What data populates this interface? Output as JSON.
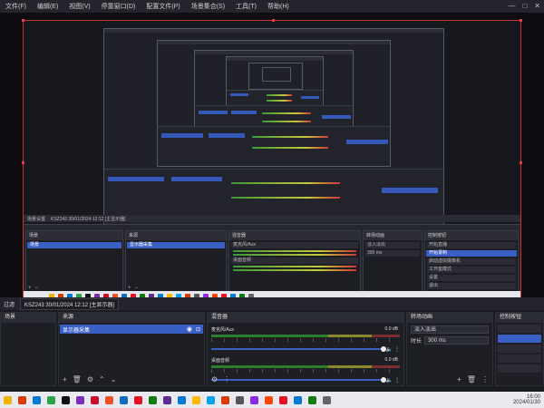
{
  "window": {
    "menu": [
      "文件(F)",
      "编辑(E)",
      "视图(V)",
      "停靠窗口(D)",
      "配置文件(P)",
      "场景集合(S)",
      "工具(T)",
      "帮助(H)"
    ],
    "controls": [
      "—",
      "□",
      "✕"
    ]
  },
  "scene_toolbar": {
    "label": "过滤",
    "source_name": "KSZ243 30/01/2024 12:12 [主显示器]"
  },
  "panels": {
    "scenes": {
      "title": "场景",
      "items": []
    },
    "sources": {
      "title": "来源",
      "items": [
        {
          "label": "显示器采集"
        }
      ]
    },
    "mixer": {
      "title": "混音器",
      "channels": [
        {
          "name": "麦克风/Aux",
          "db": "0.0 dB"
        },
        {
          "name": "桌面音频",
          "db": "0.0 dB"
        }
      ]
    },
    "transitions": {
      "title": "转场动画",
      "type": "淡入淡出",
      "duration_label": "时长",
      "duration": "300 ms"
    },
    "controls": {
      "title": "控制按钮"
    }
  },
  "inner": {
    "scene_label": "场景设置",
    "source_name": "KSZ243 30/01/2024 12:12 [主显示器]",
    "scenes_title": "场景",
    "sources_title": "来源",
    "source_item": "显示器采集",
    "scene_item": "场景",
    "mixer_title": "混音器",
    "ch1": "麦克风/Aux",
    "ch2": "桌面音频",
    "db": "0.0 dB",
    "transitions_title": "转场动画",
    "trans_type": "淡入淡出",
    "trans_dur": "300 ms",
    "controls_title": "控制按钮",
    "controls": [
      "开始直播",
      "开始录制",
      "启动虚拟摄像机",
      "工作室模式",
      "设置",
      "退出"
    ]
  },
  "taskbar": {
    "icon_colors": [
      "#f0b400",
      "#d83b01",
      "#0078d4",
      "#2aa34a",
      "#111111",
      "#7a2fb5",
      "#c8102e",
      "#f25022",
      "#0f6cbd",
      "#e81123",
      "#107c10",
      "#5c2d91",
      "#0078d4",
      "#ffb900",
      "#00a4ef",
      "#d83b01",
      "#555555",
      "#8a2be2",
      "#ff4500",
      "#e81123",
      "#0078d4",
      "#107c10",
      "#666666"
    ],
    "time": "16:00",
    "date": "2024/01/30"
  },
  "colors": {
    "accent": "#3a5fc4",
    "selection_border": "#c23030"
  }
}
